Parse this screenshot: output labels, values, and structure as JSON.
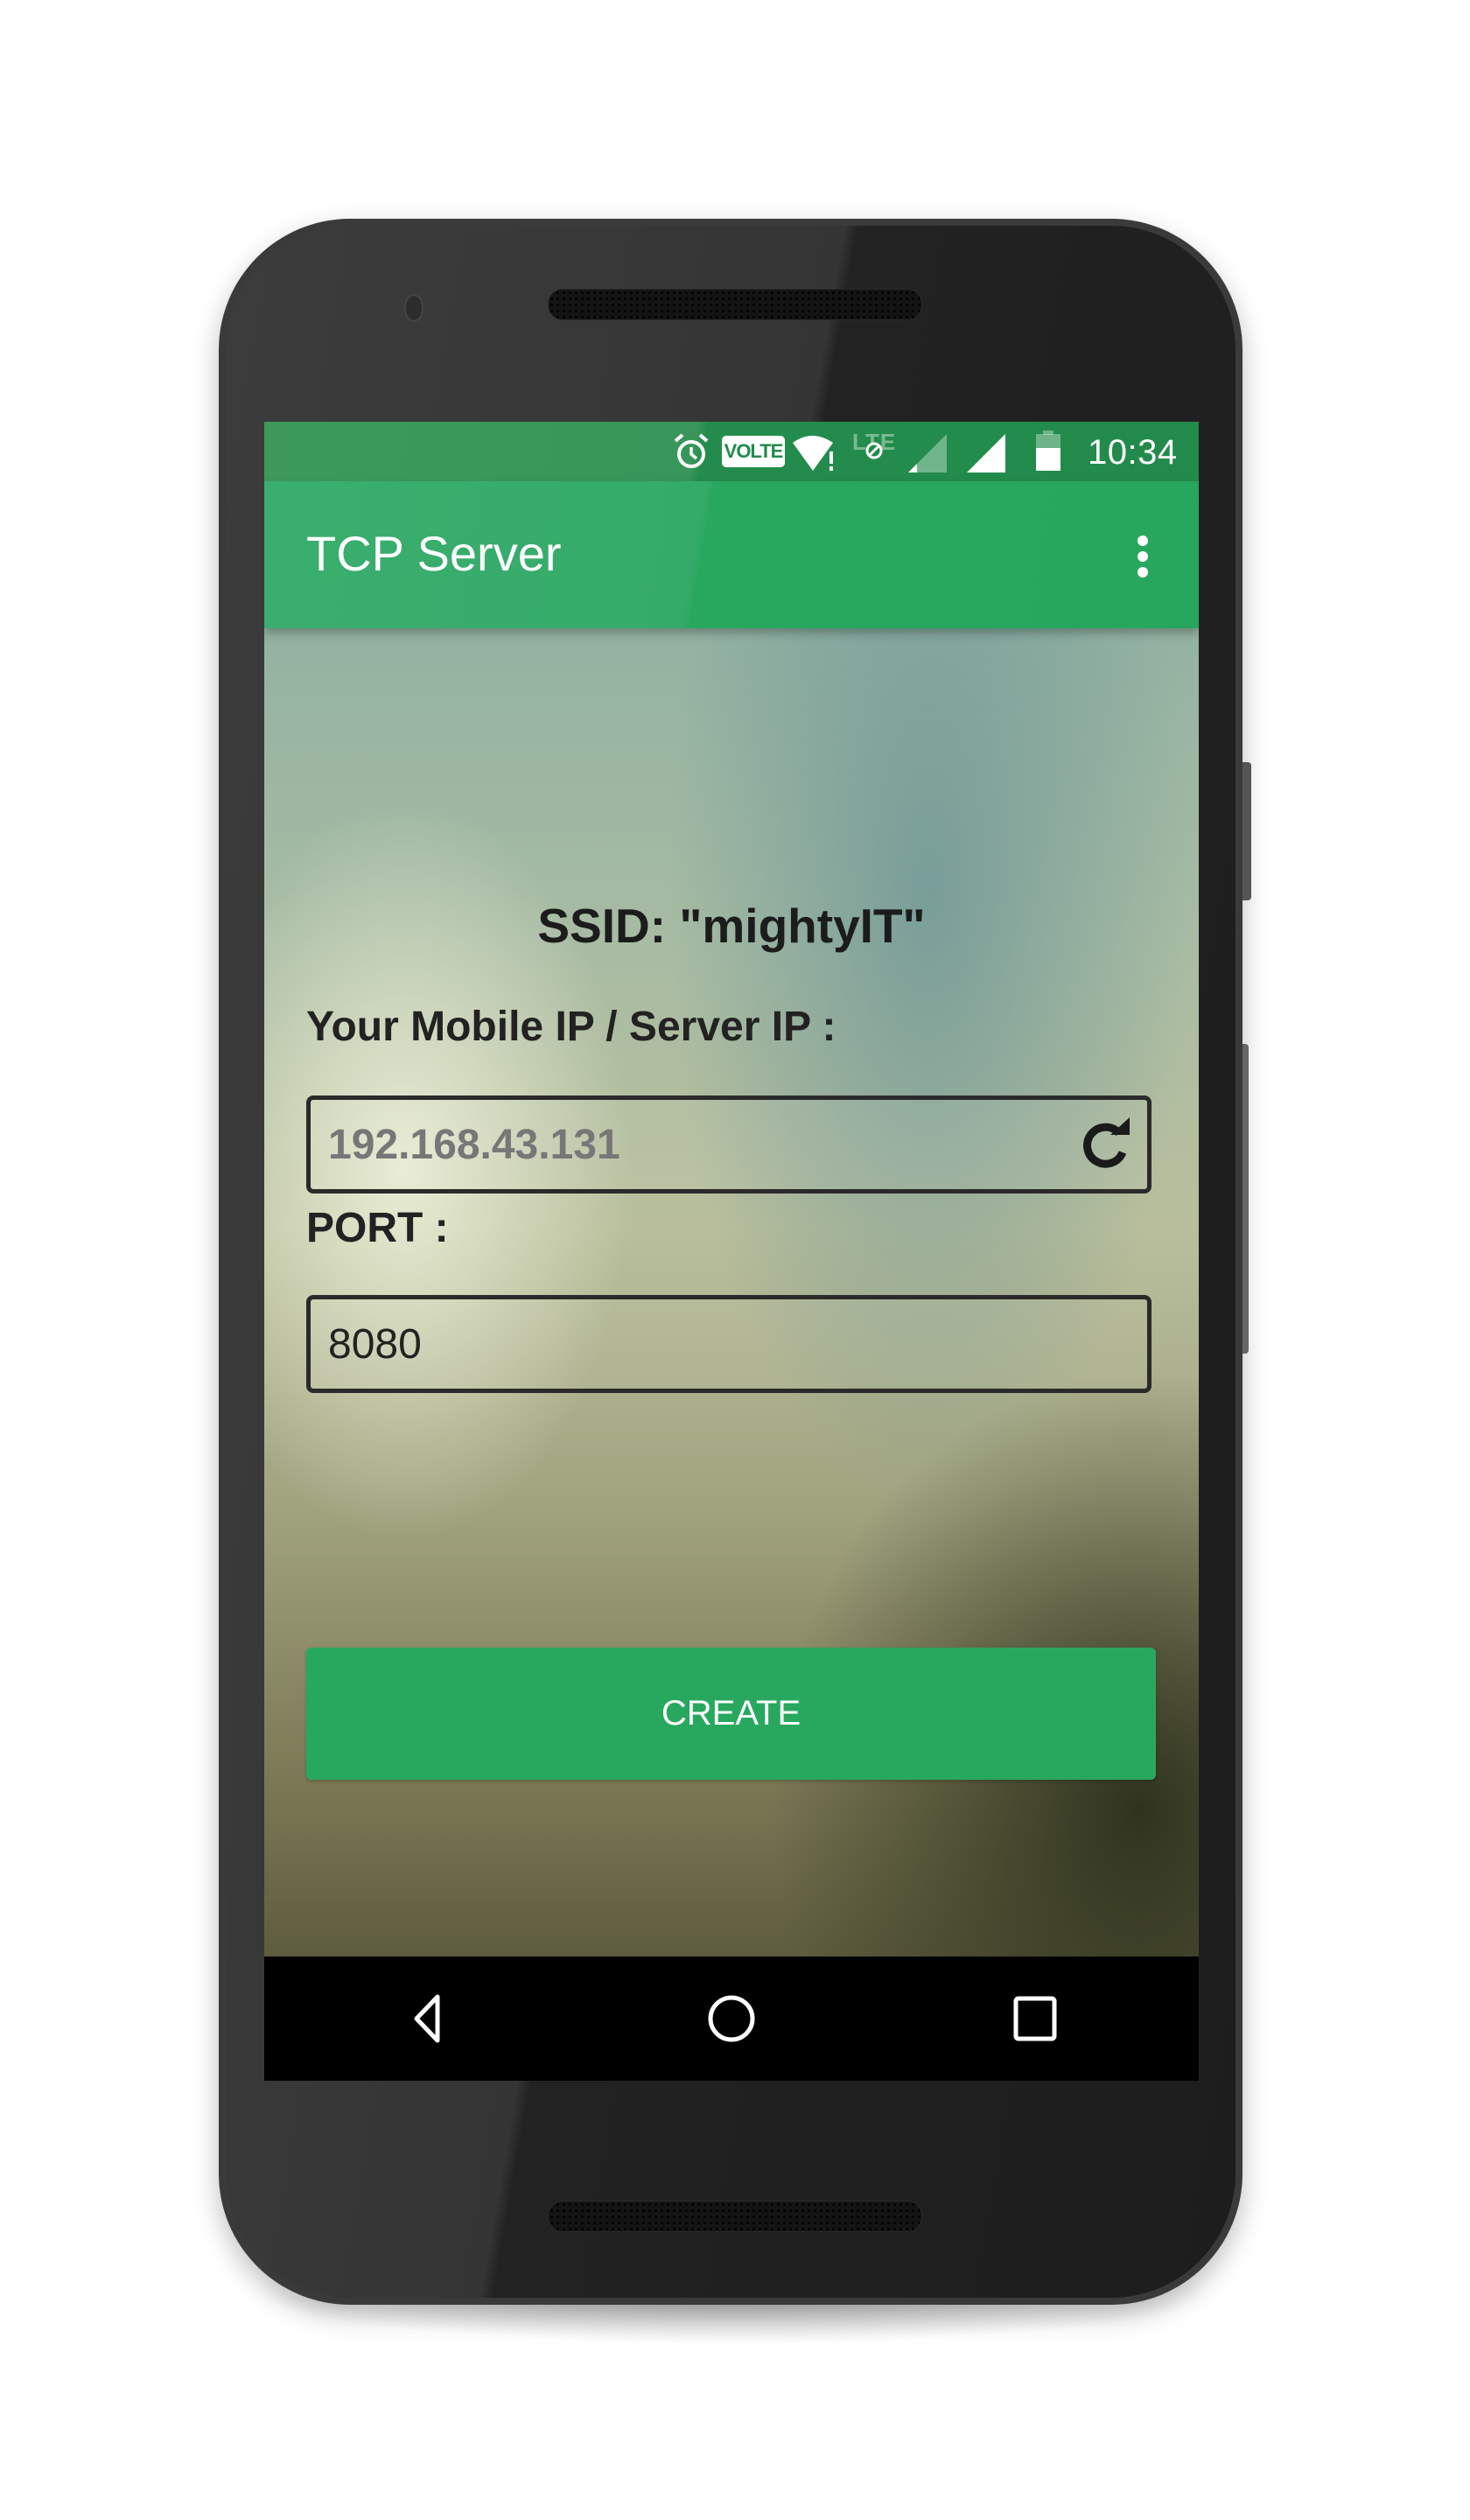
{
  "status_bar": {
    "icons": [
      "alarm-icon",
      "volte-icon",
      "wifi-no-internet-icon",
      "lte-disabled-icon",
      "signal-sim1-icon",
      "signal-sim2-icon",
      "battery-icon"
    ],
    "volte_label": "VOLTE",
    "lte_label": "LTE",
    "time": "10:34"
  },
  "app_bar": {
    "title": "TCP Server",
    "menu_icon": "overflow-menu-icon"
  },
  "main": {
    "ssid_text": "SSID: \"mightyIT\"",
    "ip_label": "Your Mobile IP / Server IP :",
    "ip_value": "192.168.43.131",
    "refresh_icon": "refresh-icon",
    "port_label": "PORT :",
    "port_value": "8080",
    "create_label": "CREATE"
  },
  "nav_bar": {
    "buttons": [
      "back",
      "home",
      "recents"
    ]
  },
  "colors": {
    "primary": "#27a75d",
    "primary_dark": "#228b4b",
    "button": "#28a85e"
  }
}
